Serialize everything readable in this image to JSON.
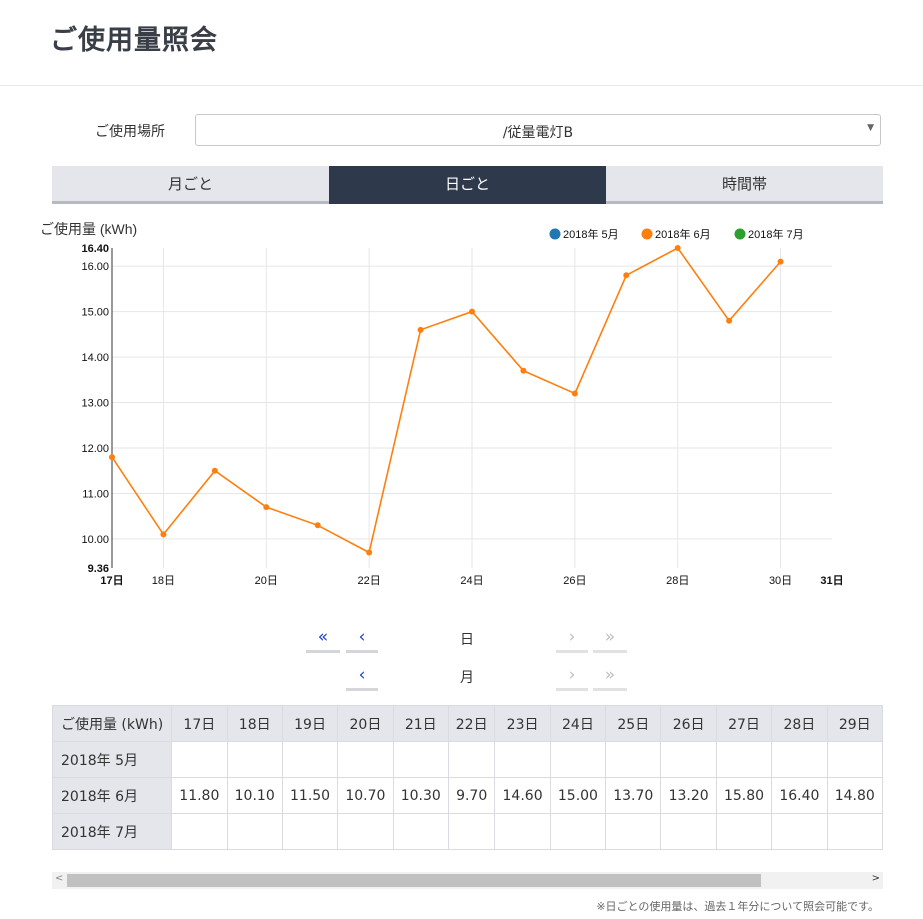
{
  "page": {
    "title": "ご使用量照会"
  },
  "location": {
    "label": "ご使用場所",
    "value": "/従量電灯B"
  },
  "tabs": [
    {
      "label": "月ごと",
      "active": false
    },
    {
      "label": "日ごと",
      "active": true
    },
    {
      "label": "時間帯",
      "active": false
    }
  ],
  "chart_data": {
    "type": "line",
    "ylabel": "ご使用量 (kWh)",
    "ylim": [
      9.36,
      16.4
    ],
    "y_ticks": [
      "9.36",
      "10.00",
      "11.00",
      "12.00",
      "13.00",
      "14.00",
      "15.00",
      "16.00",
      "16.40"
    ],
    "x_ticks": [
      "17日",
      "18日",
      "20日",
      "22日",
      "24日",
      "26日",
      "28日",
      "30日",
      "31日"
    ],
    "x": [
      17,
      18,
      19,
      20,
      21,
      22,
      23,
      24,
      25,
      26,
      27,
      28,
      29,
      30
    ],
    "xlim": [
      17,
      31
    ],
    "legend_placement": "top-right",
    "series": [
      {
        "name": "2018年 5月",
        "color": "#1f77b4",
        "values": []
      },
      {
        "name": "2018年 6月",
        "color": "#ff7f0e",
        "values": [
          11.8,
          10.1,
          11.5,
          10.7,
          10.3,
          9.7,
          14.6,
          15.0,
          13.7,
          13.2,
          15.8,
          16.4,
          14.8,
          16.1
        ]
      },
      {
        "name": "2018年 7月",
        "color": "#2ca02c",
        "values": []
      }
    ],
    "grid": true
  },
  "pager": {
    "day": {
      "label": "日",
      "first": "«",
      "prev": "‹",
      "next": "›",
      "last": "»"
    },
    "month": {
      "label": "月",
      "prev": "‹",
      "next": "›",
      "last": "»"
    }
  },
  "table": {
    "header_label": "ご使用量 (kWh)",
    "columns": [
      "17日",
      "18日",
      "19日",
      "20日",
      "21日",
      "22日",
      "23日",
      "24日",
      "25日",
      "26日",
      "27日",
      "28日",
      "29日"
    ],
    "rows": [
      {
        "label": "2018年 5月",
        "values": [
          "",
          "",
          "",
          "",
          "",
          "",
          "",
          "",
          "",
          "",
          "",
          "",
          ""
        ]
      },
      {
        "label": "2018年 6月",
        "values": [
          "11.80",
          "10.10",
          "11.50",
          "10.70",
          "10.30",
          "9.70",
          "14.60",
          "15.00",
          "13.70",
          "13.20",
          "15.80",
          "16.40",
          "14.80"
        ]
      },
      {
        "label": "2018年 7月",
        "values": [
          "",
          "",
          "",
          "",
          "",
          "",
          "",
          "",
          "",
          "",
          "",
          "",
          ""
        ]
      }
    ]
  },
  "footnote": "※日ごとの使用量は、過去１年分について照会可能です。"
}
